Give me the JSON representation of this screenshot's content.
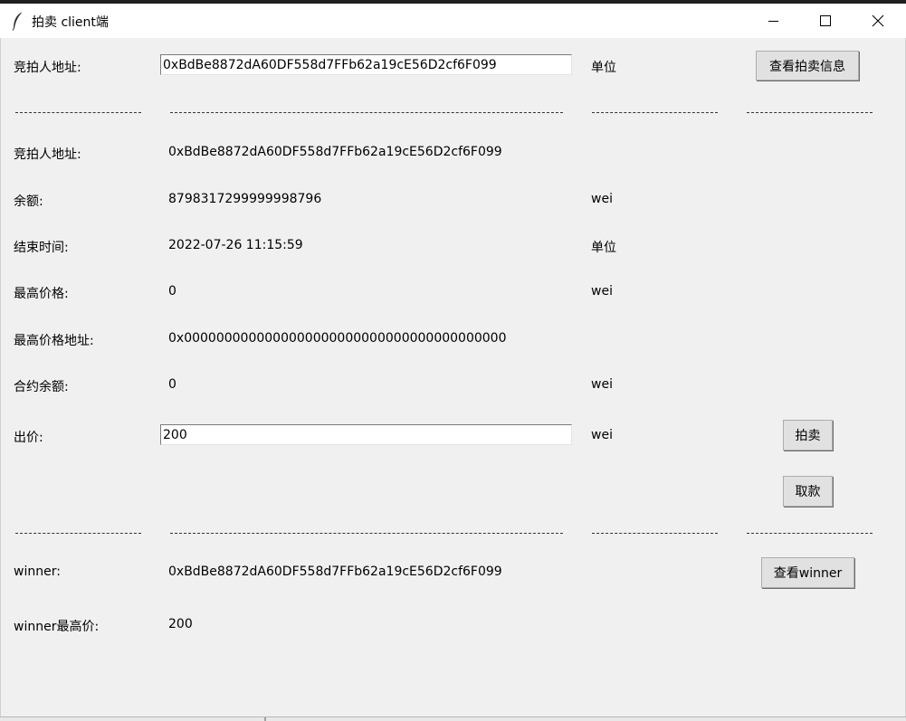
{
  "window": {
    "title": "拍卖 client端"
  },
  "top_section": {
    "bidder_label": "竞拍人地址:",
    "bidder_input_value": "0xBdBe8872dA60DF558d7FFb62a19cE56D2cf6F099",
    "unit_label": "单位",
    "view_auction_button": "查看拍卖信息"
  },
  "info": {
    "bidder_label": "竞拍人地址:",
    "bidder_value": "0xBdBe8872dA60DF558d7FFb62a19cE56D2cf6F099",
    "balance_label": "余额:",
    "balance_value": "8798317299999998796",
    "balance_unit": "wei",
    "end_time_label": "结束时间:",
    "end_time_value": "2022-07-26 11:15:59",
    "end_time_unit": "单位",
    "highest_price_label": "最高价格:",
    "highest_price_value": "0",
    "highest_price_unit": "wei",
    "highest_addr_label": "最高价格地址:",
    "highest_addr_value": "0x0000000000000000000000000000000000000000",
    "contract_balance_label": "合约余额:",
    "contract_balance_value": "0",
    "contract_balance_unit": "wei"
  },
  "bid": {
    "label": "出价:",
    "input_value": "200",
    "unit": "wei",
    "bid_button": "拍卖",
    "withdraw_button": "取款"
  },
  "winner": {
    "label": "winner:",
    "value": "0xBdBe8872dA60DF558d7FFb62a19cE56D2cf6F099",
    "view_button": "查看winner",
    "price_label": "winner最高价:",
    "price_value": "200"
  }
}
